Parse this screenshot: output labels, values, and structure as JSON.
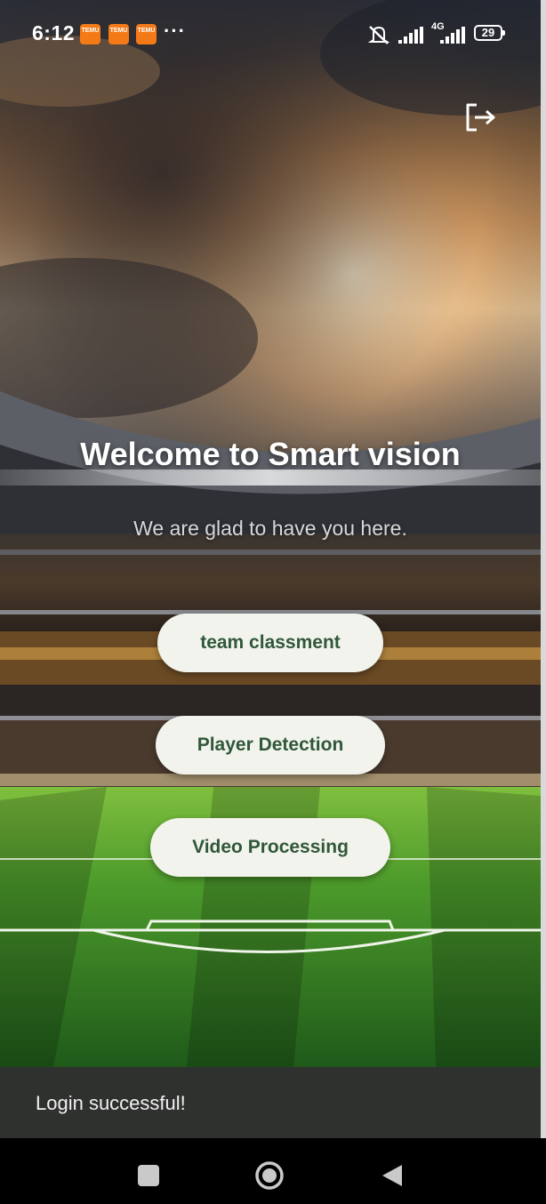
{
  "status_bar": {
    "time": "6:12",
    "notification_icons": [
      "temu-icon",
      "temu-icon",
      "temu-icon"
    ],
    "notification_icon_label": "TEMU",
    "more_indicator": "···",
    "network_label": "4G",
    "battery_level": "29"
  },
  "header": {
    "logout_icon": "logout-icon"
  },
  "welcome": {
    "title": "Welcome to Smart vision",
    "subtitle": "We are glad to have you here."
  },
  "actions": [
    {
      "label": "team classment"
    },
    {
      "label": "Player Detection"
    },
    {
      "label": "Video Processing"
    }
  ],
  "snackbar": {
    "message": "Login successful!"
  },
  "navigation": {
    "recents_icon": "square-icon",
    "home_icon": "circle-icon",
    "back_icon": "triangle-back-icon"
  },
  "colors": {
    "button_background": "#f1f3ec",
    "button_text": "#31573a",
    "snackbar_background": "#2f312f",
    "notification_icon": "#f47a18"
  }
}
